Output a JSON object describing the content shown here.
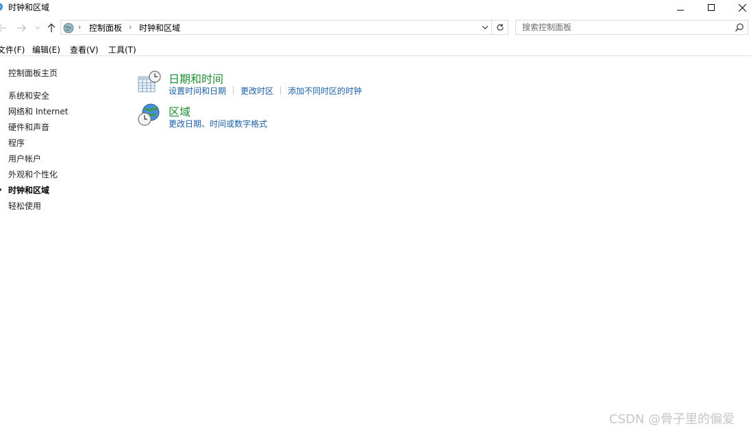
{
  "window": {
    "title": "时钟和区域"
  },
  "address": {
    "crumbs": [
      "控制面板",
      "时钟和区域"
    ]
  },
  "search": {
    "placeholder": "搜索控制面板"
  },
  "menu": [
    "文件(F)",
    "编辑(E)",
    "查看(V)",
    "工具(T)"
  ],
  "sidebar": {
    "home": "控制面板主页",
    "items": [
      "系统和安全",
      "网络和 Internet",
      "硬件和声音",
      "程序",
      "用户帐户",
      "外观和个性化",
      "时钟和区域",
      "轻松使用"
    ],
    "active_index": 6
  },
  "categories": [
    {
      "title": "日期和时间",
      "icon": "calendar-clock-icon",
      "links": [
        "设置时间和日期",
        "更改时区",
        "添加不同时区的时钟"
      ]
    },
    {
      "title": "区域",
      "icon": "globe-clock-icon",
      "links": [
        "更改日期、时间或数字格式"
      ]
    }
  ],
  "watermark": "CSDN @骨子里的偏爱",
  "colors": {
    "category_title": "#1e8c32",
    "link": "#1a5fa8"
  }
}
